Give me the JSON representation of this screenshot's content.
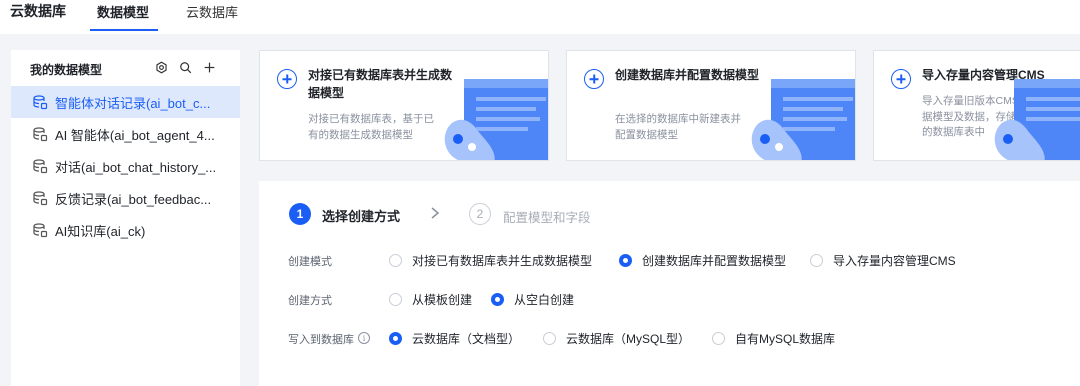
{
  "header": {
    "app_title": "云数据库",
    "tabs": [
      {
        "label": "数据模型",
        "active": true
      },
      {
        "label": "云数据库",
        "active": false
      }
    ]
  },
  "sidebar": {
    "title": "我的数据模型",
    "icons": [
      "settings-icon",
      "search-icon",
      "plus-icon"
    ],
    "items": [
      {
        "label": "智能体对话记录(ai_bot_c...",
        "active": true
      },
      {
        "label": "AI 智能体(ai_bot_agent_4...",
        "active": false
      },
      {
        "label": "对话(ai_bot_chat_history_...",
        "active": false
      },
      {
        "label": "反馈记录(ai_bot_feedbac...",
        "active": false
      },
      {
        "label": "AI知识库(ai_ck)",
        "active": false
      }
    ]
  },
  "cards": [
    {
      "title": "对接已有数据库表并生成数据模型",
      "description": "对接已有数据库表，基于已有的数据生成数据模型"
    },
    {
      "title": "创建数据库并配置数据模型",
      "description": "在选择的数据库中新建表并配置数据模型"
    },
    {
      "title": "导入存量内容管理CMS",
      "description": "导入存量旧版本CMS中的数据模型及数据，存储到指定的数据库表中"
    }
  ],
  "steps": [
    {
      "number": "1",
      "label": "选择创建方式",
      "active": true
    },
    {
      "number": "2",
      "label": "配置模型和字段",
      "active": false
    }
  ],
  "form": {
    "mode": {
      "label": "创建模式",
      "options": [
        {
          "label": "对接已有数据库表并生成数据模型",
          "checked": false
        },
        {
          "label": "创建数据库并配置数据模型",
          "checked": true
        },
        {
          "label": "导入存量内容管理CMS",
          "checked": false
        }
      ]
    },
    "method": {
      "label": "创建方式",
      "options": [
        {
          "label": "从模板创建",
          "checked": false
        },
        {
          "label": "从空白创建",
          "checked": true
        }
      ]
    },
    "target": {
      "label": "写入到数据库",
      "info": "i",
      "options": [
        {
          "label": "云数据库（文档型）",
          "checked": true
        },
        {
          "label": "云数据库（MySQL型）",
          "checked": false
        },
        {
          "label": "自有MySQL数据库",
          "checked": false
        }
      ]
    }
  },
  "colors": {
    "accent": "#1b5ef5",
    "active_bg": "#dde8fd",
    "page_bg": "#f2f4f8"
  }
}
